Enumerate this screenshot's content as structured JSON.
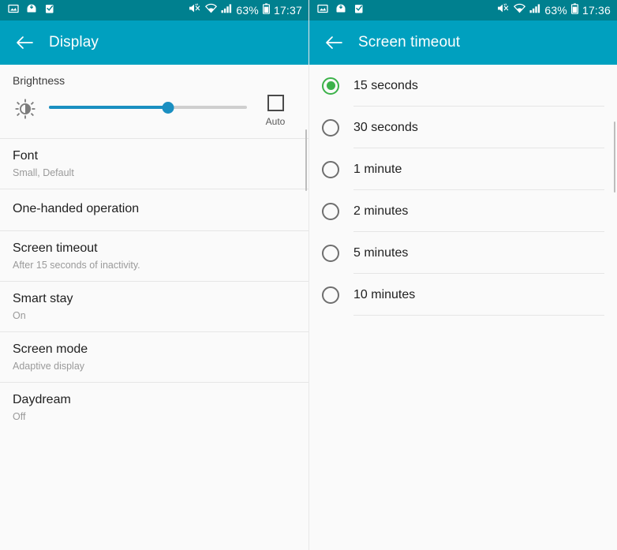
{
  "screens": [
    {
      "id": "display-settings",
      "statusbar": {
        "notif_icons": [
          "image-icon",
          "save-icon",
          "screenshot-icon"
        ],
        "mute_icon": "mute-icon",
        "wifi_icon": "wifi-icon",
        "signal_icon": "signal-icon",
        "battery_percent": "63%",
        "battery_icon": "battery-icon",
        "time": "17:37"
      },
      "appbar": {
        "back_icon": "back-arrow-icon",
        "title": "Display"
      },
      "brightness": {
        "label": "Brightness",
        "icon": "brightness-icon",
        "value_percent": 60,
        "auto_label": "Auto",
        "auto_checked": false
      },
      "items": [
        {
          "title": "Font",
          "subtitle": "Small, Default"
        },
        {
          "title": "One-handed operation",
          "subtitle": ""
        },
        {
          "title": "Screen timeout",
          "subtitle": "After 15 seconds of inactivity."
        },
        {
          "title": "Smart stay",
          "subtitle": "On"
        },
        {
          "title": "Screen mode",
          "subtitle": "Adaptive display"
        },
        {
          "title": "Daydream",
          "subtitle": "Off"
        }
      ]
    },
    {
      "id": "screen-timeout",
      "statusbar": {
        "notif_icons": [
          "image-icon",
          "save-icon",
          "screenshot-icon"
        ],
        "mute_icon": "mute-icon",
        "wifi_icon": "wifi-icon",
        "signal_icon": "signal-icon",
        "battery_percent": "63%",
        "battery_icon": "battery-icon",
        "time": "17:36"
      },
      "appbar": {
        "back_icon": "back-arrow-icon",
        "title": "Screen timeout"
      },
      "options": [
        {
          "label": "15 seconds",
          "selected": true
        },
        {
          "label": "30 seconds",
          "selected": false
        },
        {
          "label": "1 minute",
          "selected": false
        },
        {
          "label": "2 minutes",
          "selected": false
        },
        {
          "label": "5 minutes",
          "selected": false
        },
        {
          "label": "10 minutes",
          "selected": false
        }
      ]
    }
  ],
  "colors": {
    "statusbar": "#00808f",
    "appbar": "#00a0bf",
    "accent_slider": "#1a8fc1",
    "accent_radio": "#3cb24a",
    "background": "#fafafa"
  }
}
